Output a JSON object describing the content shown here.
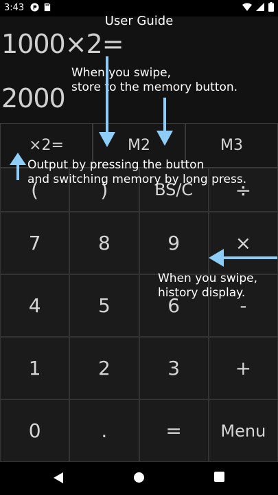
{
  "status_bar": {
    "time": "3:43",
    "icons": [
      "app-p-icon",
      "sd-card-icon",
      "wifi-icon",
      "signal-icon",
      "battery-icon"
    ]
  },
  "guide": {
    "title": "User Guide",
    "note_memory": "When you swipe,\nstore to the memory button.",
    "note_output": "Output by pressing the button\nand switching memory by long press.",
    "note_history": "When you swipe,\nhistory display."
  },
  "display": {
    "expression": "1000×2=",
    "result": "2000"
  },
  "memory": [
    "×2=",
    "M2",
    "M3"
  ],
  "keys": [
    "(",
    ")",
    "BS/C",
    "÷",
    "7",
    "8",
    "9",
    "×",
    "4",
    "5",
    "6",
    "-",
    "1",
    "2",
    "3",
    "+",
    "0",
    ".",
    "=",
    "Menu"
  ],
  "colors": {
    "arrow": "#8ecdf7",
    "background": "#1e1e1e"
  },
  "nav_icons": [
    "back-icon",
    "home-icon",
    "recents-icon"
  ]
}
